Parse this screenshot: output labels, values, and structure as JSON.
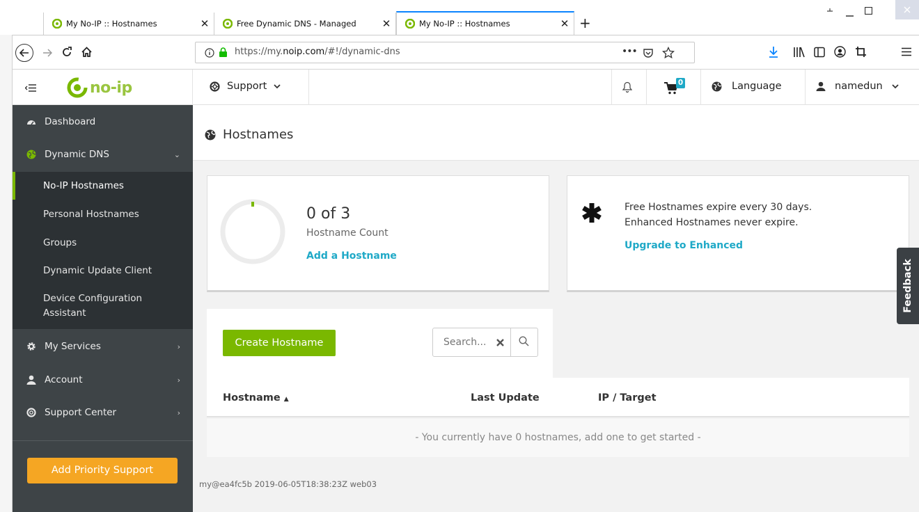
{
  "browser": {
    "tabs": [
      {
        "title": "My No-IP :: Hostnames",
        "close": "✕",
        "active": false
      },
      {
        "title": "Free Dynamic DNS - Managed",
        "close": "✕",
        "active": false
      },
      {
        "title": "My No-IP :: Hostnames",
        "close": "✕",
        "active": true
      }
    ],
    "new_tab": "+",
    "url_prefix": "https://my.",
    "url_domain": "noip.com",
    "url_suffix": "/#!/dynamic-dns",
    "page_actions": "•••"
  },
  "header": {
    "logo_text": "no-ip",
    "support_label": "Support",
    "cart_count": "0",
    "language_label": "Language",
    "username": "namedun"
  },
  "sidebar": {
    "dashboard": "Dashboard",
    "dynamic_dns": "Dynamic DNS",
    "sub_items": [
      "No-IP Hostnames",
      "Personal Hostnames",
      "Groups",
      "Dynamic Update Client",
      "Device Configuration",
      "Assistant"
    ],
    "my_services": "My Services",
    "account": "Account",
    "support_center": "Support Center",
    "priority_button": "Add Priority Support"
  },
  "page": {
    "title": "Hostnames"
  },
  "count_card": {
    "count_text": "0 of 3",
    "count_value": 0,
    "count_max": 3,
    "label": "Hostname Count",
    "link": "Add a Hostname"
  },
  "info_card": {
    "line1": "Free Hostnames expire every 30 days.",
    "line2": "Enhanced Hostnames never expire.",
    "link": "Upgrade to Enhanced"
  },
  "table": {
    "create_button": "Create Hostname",
    "search_placeholder": "Search...",
    "columns": [
      "Hostname",
      "Last Update",
      "IP / Target"
    ],
    "empty_message": "- You currently have 0 hostnames, add one to get started -"
  },
  "footer": "my@ea4fc5b 2019-06-05T18:38:23Z web03",
  "feedback": "Feedback",
  "colors": {
    "brand_green": "#7ab800",
    "link_teal": "#1fa9c7",
    "sidebar_dark": "#3e4447",
    "priority_orange": "#f5a623"
  }
}
